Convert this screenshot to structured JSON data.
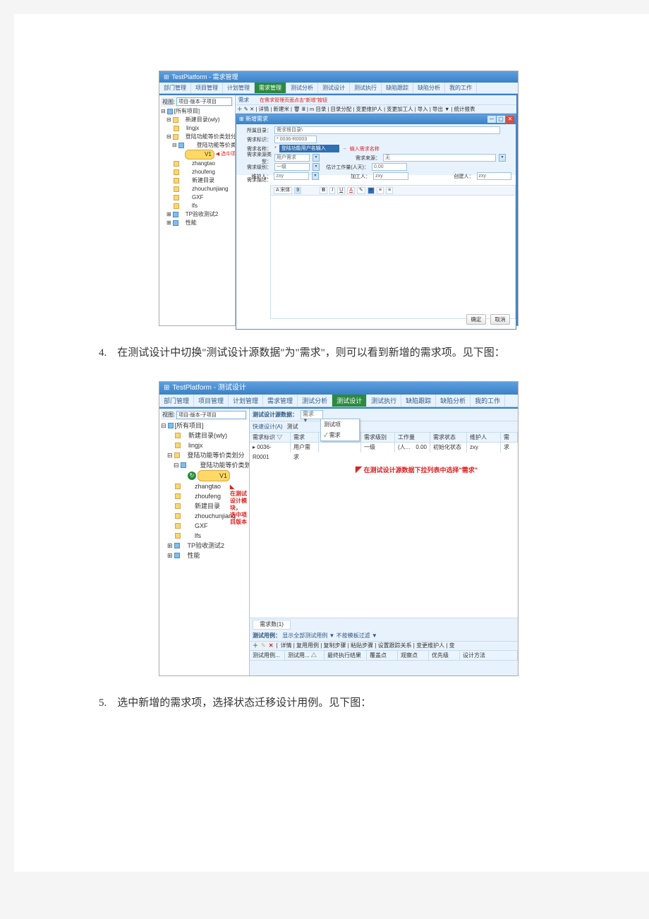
{
  "screenshot1": {
    "title": "TestPlatform - 需求管理",
    "tabs": [
      "部门管理",
      "项目管理",
      "计划管理",
      "需求管理",
      "测试分析",
      "测试设计",
      "测试执行",
      "缺陷跟踪",
      "缺陷分析",
      "我的工作"
    ],
    "active_tab_index": 3,
    "view_label": "视图:",
    "view_value": "项目-版本-子项目",
    "tree": [
      "[所有项目]",
      "　新建目录(wly)",
      "　lingjx",
      "　登陆功能等价类划分",
      "　　登陆功能等价类划",
      "　　　V1",
      "　　zhangtao",
      "　　zhoufeng",
      "　　新建目录",
      "　　zhouchunjiang",
      "　　GXF",
      "　　lfs",
      "　TP验收测试2",
      "　性能"
    ],
    "tree_ann": "选中项目版本",
    "toolbar_ann": "在需求管理页面点击\"新增\"按钮",
    "toolbar_items": "详情 | 新建米 | 🗑 Ⅲ | m 目录 | 目录分配 |  变更维护人 | 变更加工人 | 导入 | 导出 ▼ | 统计报表",
    "modal": {
      "title": "新增需求",
      "fields": {
        "dir_lab": "所属目录：",
        "dir_val": "需求根目录\\",
        "id_lab": "需求标识：",
        "id_val": "* 0036-R0003",
        "name_lab": "需求名称：",
        "name_val": "登陆功能用户名输入",
        "name_ann": "输入需求名称",
        "src_type_lab": "需求来源类型：",
        "src_type_val": "用户需求",
        "src_lab": "需求来源：",
        "src_val": "无",
        "level_lab": "需求级别：",
        "level_val": "一级",
        "work_lab": "估计工作量(人天)：",
        "work_val": "0.00",
        "owner_lab": "维护人：",
        "owner_val": "zxy",
        "worker_lab": "加工人：",
        "worker_val": "zxy",
        "creator_lab": "创建人：",
        "creator_val": "zxy",
        "desc_lab": "需求描述："
      },
      "rte": {
        "font_lab": "A 宋体",
        "size": "9"
      },
      "ok": "确定",
      "cancel": "取消"
    }
  },
  "caption4": "4.　在测试设计中切换\"测试设计源数据\"为\"需求\"，则可以看到新增的需求项。见下图：",
  "screenshot2": {
    "title": "TestPlatform - 测试设计",
    "tabs": [
      "部门管理",
      "项目管理",
      "计划管理",
      "需求管理",
      "测试分析",
      "测试设计",
      "测试执行",
      "缺陷跟踪",
      "缺陷分析",
      "我的工作"
    ],
    "active_tab_index": 5,
    "view_label": "视图:",
    "view_value": "项目-版本-子项目",
    "tree": [
      "[所有项目]",
      "　新建目录(wly)",
      "　lingjx",
      "　登陆功能等价类划分",
      "　　登陆功能等价类划",
      "　　　V1",
      "　　zhangtao",
      "　　zhoufeng",
      "　　新建目录",
      "　　zhouchunjiang",
      "　　GXF",
      "　　lfs",
      "　TP验收测试2",
      "　性能"
    ],
    "tree_ann_line1": "在测试设计模块，",
    "tree_ann_line2": "选中项目版本",
    "src_label": "测试设计源数据：",
    "src_value": "需求 ▼",
    "dd_options": [
      "测试项",
      "需求"
    ],
    "quick_design": "快速设计(A)",
    "quick_test": "测试",
    "grid": {
      "headers": [
        "需求标识 ▽",
        "需求",
        "需求级别",
        "工作量(人...",
        "需求状态",
        "维护人",
        "需求"
      ],
      "row": [
        "▸ 0036-R0001",
        "用户需求",
        "",
        "一级",
        "0.00",
        "初始化状态",
        "zxy"
      ]
    },
    "grid_ann": "在测试设计源数据下拉列表中选择\"需求\"",
    "bottom": {
      "tab": "需求数(1)",
      "cases_label": "测试用例：",
      "cases_text": "显示全部测试用例 ▼ 不按模板过滤 ▼",
      "tb_items": "详情 | 复用用例 | 复制步骤 | 粘贴步骤 | 设置跟踪关系 | 变更维护人 | 变",
      "cols": [
        "测试用例...",
        "测试用... △",
        "最终执行结果",
        "覆盖点",
        "观察点",
        "优先级",
        "设计方法"
      ]
    }
  },
  "caption5": "5.　选中新增的需求项，选择状态迁移设计用例。见下图："
}
